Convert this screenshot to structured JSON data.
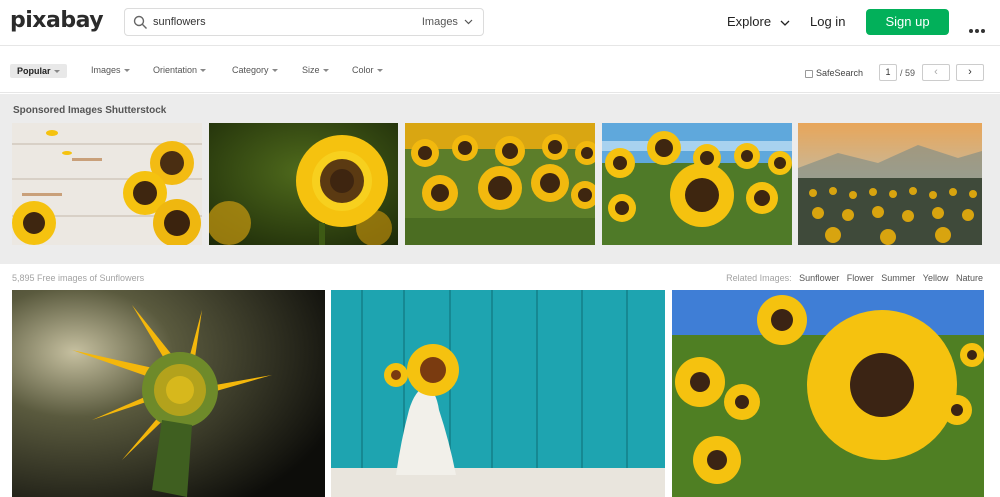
{
  "app": {
    "logo": "pixabay"
  },
  "search": {
    "query": "sunflowers",
    "type_label": "Images"
  },
  "nav": {
    "explore": "Explore",
    "login": "Log in",
    "signup": "Sign up"
  },
  "filters": {
    "popular": "Popular",
    "images": "Images",
    "orientation": "Orientation",
    "category": "Category",
    "size": "Size",
    "color": "Color"
  },
  "safesearch": {
    "label": "SafeSearch"
  },
  "pagination": {
    "current": "1",
    "total": "/ 59",
    "prev": "‹",
    "next": "›"
  },
  "sponsored": {
    "title": "Sponsored Images Shutterstock"
  },
  "results": {
    "count": "5,895 Free images of Sunflowers"
  },
  "related": {
    "label": "Related Images:",
    "tags": [
      "Sunflower",
      "Flower",
      "Summer",
      "Yellow",
      "Nature"
    ]
  },
  "colors": {
    "brand_green": "#02b05a",
    "sunflower_yellow": "#f5c20f",
    "teal_wood": "#1ea4b0"
  }
}
